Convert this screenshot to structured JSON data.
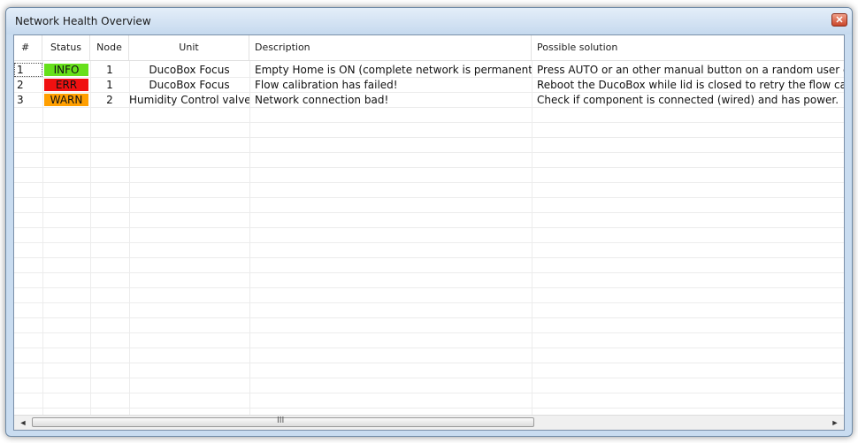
{
  "window": {
    "title": "Network Health Overview",
    "close_glyph": "✕"
  },
  "table": {
    "columns": [
      "#",
      "Status",
      "Node",
      "Unit",
      "Description",
      "Possible solution"
    ],
    "rows": [
      {
        "num": "1",
        "status": "INFO",
        "status_color": "#66e01a",
        "node": "1",
        "unit": "DucoBox Focus",
        "description": "Empty Home is ON (complete network is permanent low)",
        "solution": "Press AUTO or an other manual button on a random user contro"
      },
      {
        "num": "2",
        "status": "ERR",
        "status_color": "#f01010",
        "node": "1",
        "unit": "DucoBox Focus",
        "description": "Flow calibration has failed!",
        "solution": "Reboot the DucoBox while lid is closed to retry the flow calibrati"
      },
      {
        "num": "3",
        "status": "WARN",
        "status_color": "#ff9f00",
        "node": "2",
        "unit": "Humidity Control valve",
        "description": "Network connection bad!",
        "solution": "Check if component is connected (wired) and has power."
      }
    ]
  },
  "scrollbar": {
    "left_arrow": "◄",
    "right_arrow": "►",
    "grip": "III"
  }
}
